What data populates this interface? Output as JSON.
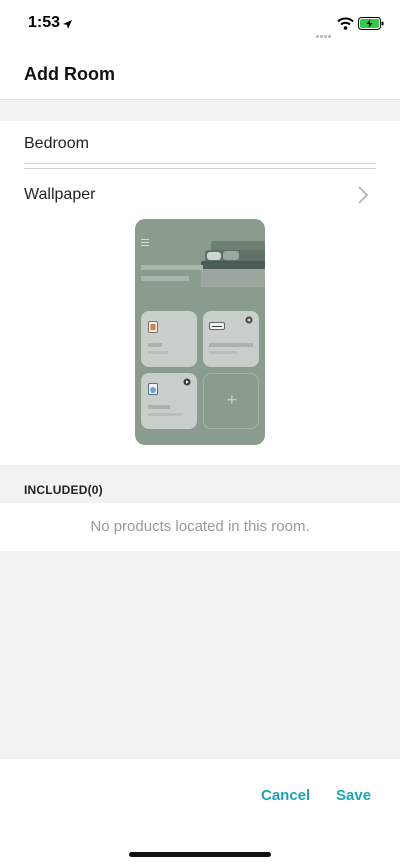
{
  "status_bar": {
    "time": "1:53",
    "icons": [
      "location-arrow-icon",
      "signal-icon",
      "wifi-icon",
      "battery-charging-icon"
    ]
  },
  "header": {
    "title": "Add Room"
  },
  "form": {
    "room_name_value": "Bedroom",
    "wallpaper_label": "Wallpaper"
  },
  "included": {
    "header": "INCLUDED(0)",
    "empty_message": "No products located in this room."
  },
  "actions": {
    "cancel_label": "Cancel",
    "save_label": "Save"
  },
  "colors": {
    "accent": "#1ba4b6",
    "preview_background": "#8a9c8e",
    "page_background": "#f2f2f2"
  }
}
